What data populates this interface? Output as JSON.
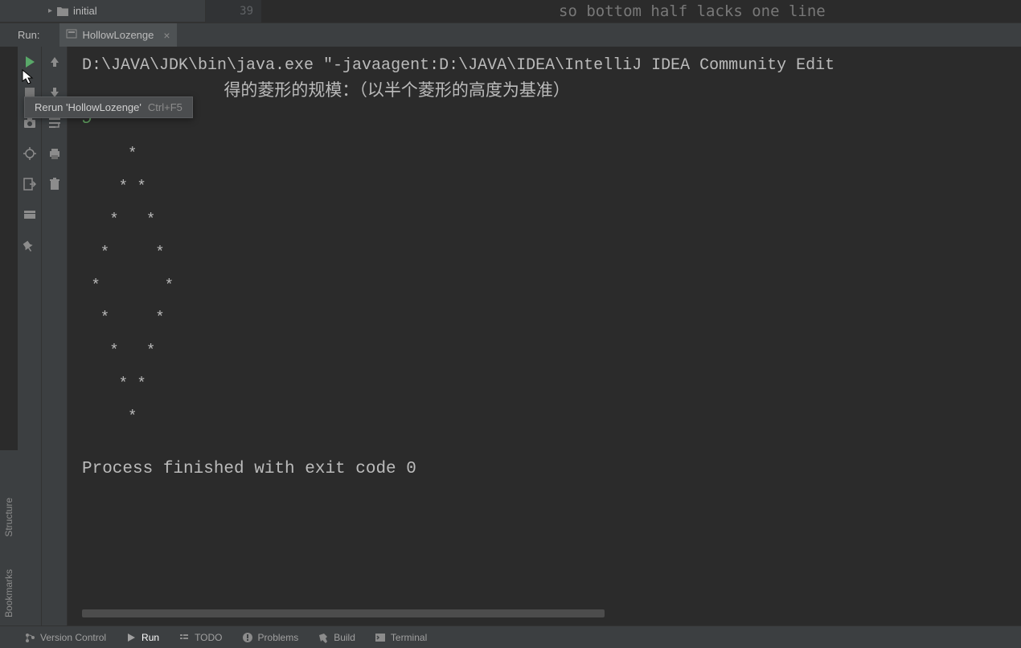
{
  "tree": {
    "item1": "initial",
    "line_number": "39"
  },
  "editor_peek": "so bottom half lacks one line",
  "run_header": {
    "label": "Run:",
    "tab_name": "HollowLozenge"
  },
  "tooltip": {
    "text": "Rerun 'HollowLozenge'",
    "shortcut": "Ctrl+F5"
  },
  "console": {
    "cmd": "D:\\JAVA\\JDK\\bin\\java.exe \"-javaagent:D:\\JAVA\\IDEA\\IntelliJ IDEA Community Edit",
    "prompt_fragment": "得的菱形的规模：（以半个菱形的高度为基准）",
    "input_value": "5",
    "diamond": "     *\n    * *\n   *   *\n  *     *\n *       *\n  *     *\n   *   *\n    * *\n     *",
    "exit_msg": "Process finished with exit code 0"
  },
  "left_rail": {
    "structure": "Structure",
    "bookmarks": "Bookmarks"
  },
  "bottom": {
    "version_control": "Version Control",
    "run": "Run",
    "todo": "TODO",
    "problems": "Problems",
    "build": "Build",
    "terminal": "Terminal"
  }
}
